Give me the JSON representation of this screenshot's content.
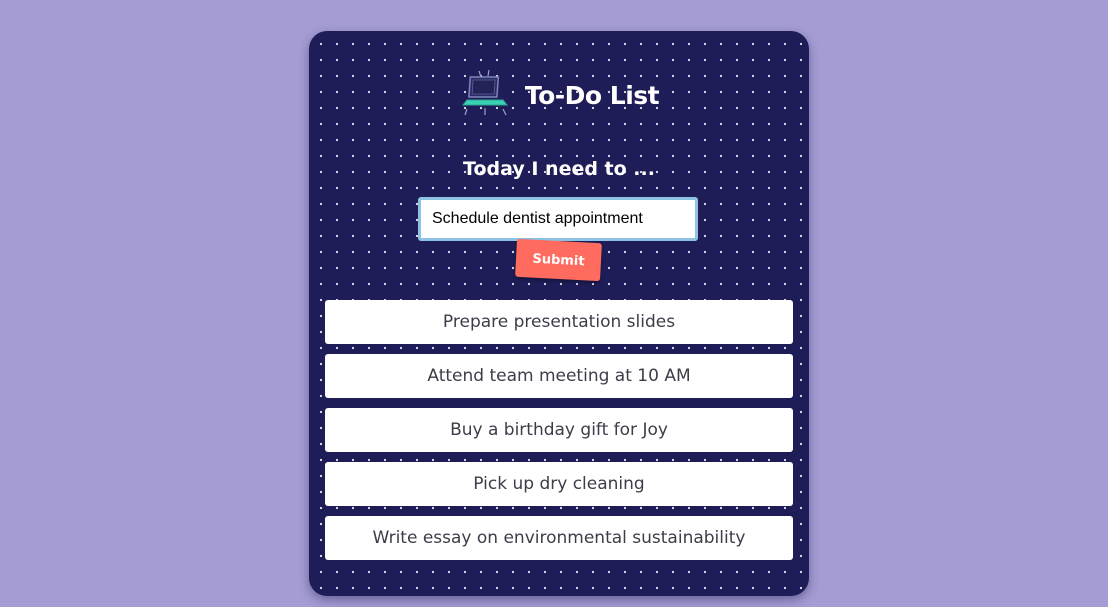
{
  "app": {
    "title": "To-Do List",
    "icon": "laptop-icon"
  },
  "form": {
    "prompt": "Today I need to ...",
    "input_value": "Schedule dentist appointment",
    "submit_label": "Submit"
  },
  "tasks": [
    {
      "label": "Prepare presentation slides"
    },
    {
      "label": "Attend team meeting at 10 AM"
    },
    {
      "label": "Buy a birthday gift for Joy"
    },
    {
      "label": "Pick up dry cleaning"
    },
    {
      "label": "Write essay on environmental sustainability"
    }
  ],
  "colors": {
    "page_background": "#a49cd3",
    "card_background": "#1e1d57",
    "submit_button": "#ff6b5e",
    "input_border": "#8fc3e4",
    "task_text": "#3d3d4a"
  }
}
